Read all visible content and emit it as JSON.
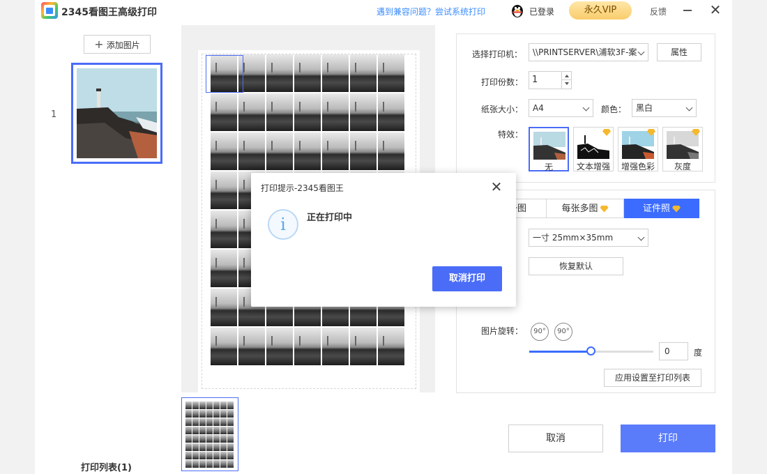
{
  "titlebar": {
    "app_title": "2345看图王高级打印",
    "help_link": "遇到兼容问题？尝试系统打印",
    "login_status": "已登录",
    "vip_label": "永久VIP",
    "feedback": "反馈"
  },
  "left_panel": {
    "add_label": "添加图片",
    "item_number": "1",
    "list_label": "打印列表(1)"
  },
  "settings": {
    "printer_label": "选择打印机：",
    "printer_value": "\\\\PRINTSERVER\\浦软3F-案",
    "properties_btn": "属性",
    "copies_label": "打印份数：",
    "copies_value": "1",
    "paper_label": "纸张大小：",
    "paper_value": "A4",
    "color_label": "颜色：",
    "color_value": "黑白",
    "effects_label": "特效：",
    "effects": [
      {
        "name": "无",
        "premium": false
      },
      {
        "name": "文本增强",
        "premium": true
      },
      {
        "name": "增强色彩",
        "premium": true
      },
      {
        "name": "灰度",
        "premium": true
      }
    ]
  },
  "layout": {
    "tabs": [
      "一图",
      "每张多图",
      "证件照"
    ],
    "size_value": "一寸 25mm×35mm",
    "restore_btn": "恢复默认",
    "rotate_label": "图片旋转：",
    "rotate_left": "90°",
    "rotate_right": "90°",
    "degree_value": "0",
    "degree_unit": "度",
    "apply_btn": "应用设置至打印列表"
  },
  "footer": {
    "cancel": "取消",
    "print": "打印"
  },
  "dialog": {
    "title": "打印提示-2345看图王",
    "message": "正在打印中",
    "cancel_print": "取消打印"
  },
  "colors": {
    "accent": "#4a6cf7",
    "print_button": "#5b7cfa",
    "premium_gem": "#f5b82e",
    "link": "#3b8cff"
  },
  "rotation_slider": {
    "fraction": 0.5
  },
  "preview_grid": {
    "columns": 7,
    "rows": 8
  }
}
